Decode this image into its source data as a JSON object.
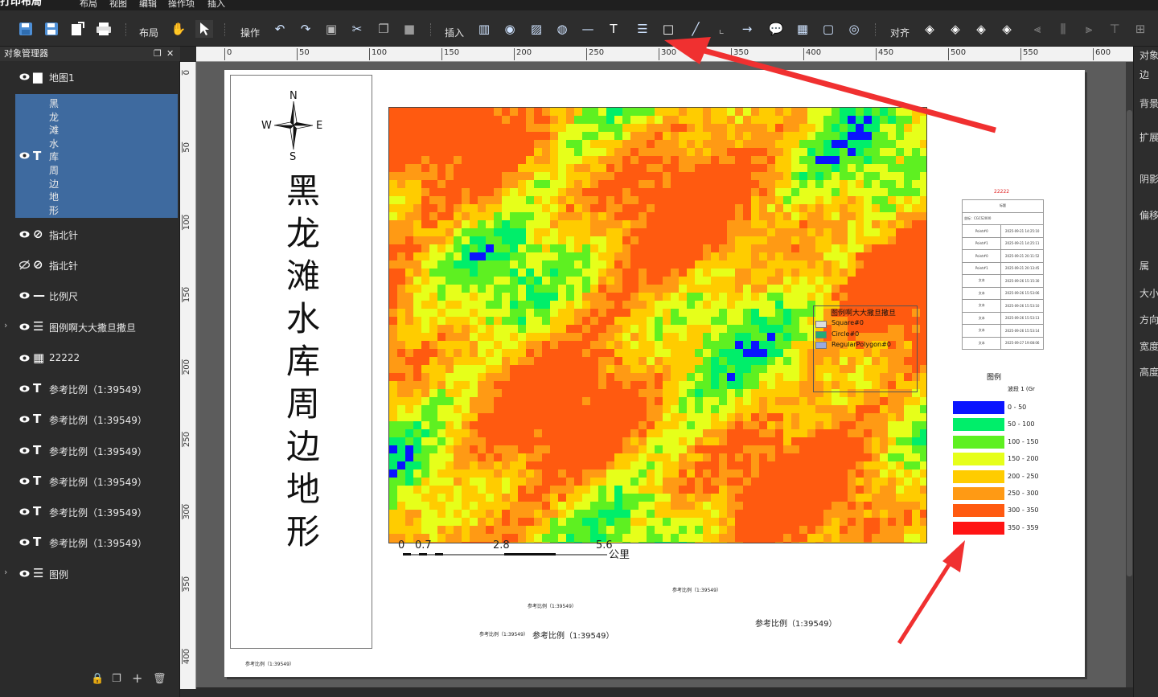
{
  "menubar": {
    "app_title": "打印布局",
    "items": [
      "布局",
      "视图",
      "编辑",
      "操作项",
      "插入"
    ]
  },
  "toolbar": {
    "group_labels": {
      "layout": "布局",
      "operate": "操作",
      "insert": "插入",
      "align": "对齐"
    }
  },
  "left_panel": {
    "title": "对象管理器",
    "items": [
      {
        "label": "地图1",
        "icon": "folder-icon"
      },
      {
        "label": "黑龙滩水库周边地形",
        "icon": "text-icon",
        "selected": true
      },
      {
        "label": "指北针",
        "icon": "compass-icon"
      },
      {
        "label": "指北针",
        "icon": "compass-icon",
        "hidden": true
      },
      {
        "label": "比例尺",
        "icon": "scalebar-icon"
      },
      {
        "label": "图例啊大大撒旦撒旦",
        "icon": "legend-icon",
        "expandable": true
      },
      {
        "label": "22222",
        "icon": "table-icon"
      },
      {
        "label": "参考比例（1:39549）",
        "icon": "text-icon"
      },
      {
        "label": "参考比例（1:39549）",
        "icon": "text-icon"
      },
      {
        "label": "参考比例（1:39549）",
        "icon": "text-icon"
      },
      {
        "label": "参考比例（1:39549）",
        "icon": "text-icon"
      },
      {
        "label": "参考比例（1:39549）",
        "icon": "text-icon"
      },
      {
        "label": "参考比例（1:39549）",
        "icon": "text-icon"
      },
      {
        "label": "图例",
        "icon": "legend-icon",
        "expandable": true
      }
    ]
  },
  "ruler": {
    "h": [
      "0",
      "50",
      "100",
      "150",
      "200",
      "250",
      "300",
      "350",
      "400",
      "450",
      "500",
      "550",
      "600"
    ],
    "v": [
      "0",
      "50",
      "100",
      "150",
      "200",
      "250",
      "300",
      "350",
      "400"
    ]
  },
  "page": {
    "compass": {
      "n": "N",
      "s": "S",
      "e": "E",
      "w": "W"
    },
    "title": "黑龙滩水库周边地形",
    "scalebar": {
      "ticks": [
        "0",
        "0.7",
        "2.8",
        "5.6"
      ],
      "unit": "公里"
    },
    "legend1": {
      "title": "图例啊大大撒旦撒旦",
      "items": [
        "Square#0",
        "Circle#0",
        "RegularPolygon#0"
      ]
    },
    "table": {
      "title": "22222",
      "header": "标题",
      "subheader": "坐标：CGCS2000",
      "rows": [
        [
          "Point#0",
          "2025-09-21 14:25:10"
        ],
        [
          "Point#1",
          "2025-09-21 14:25:11"
        ],
        [
          "Point#0",
          "2025-09-21 20:11:52"
        ],
        [
          "Point#1",
          "2025-09-21 20:13:45"
        ],
        [
          "文本",
          "2025-09-26 15:15:30"
        ],
        [
          "文本",
          "2025-09-26 15:53:06"
        ],
        [
          "文本",
          "2025-09-26 15:53:10"
        ],
        [
          "文本",
          "2025-09-26 15:53:13"
        ],
        [
          "文本",
          "2025-09-26 15:53:14"
        ],
        [
          "文本",
          "2025-09-27 19:08:06"
        ]
      ]
    },
    "legend2": {
      "title": "图例",
      "subtitle": "波段 1 (Gr",
      "items": [
        {
          "label": "0 - 50",
          "color": "#0a14ff"
        },
        {
          "label": "50 - 100",
          "color": "#00ee6a"
        },
        {
          "label": "100 - 150",
          "color": "#5ef021"
        },
        {
          "label": "150 - 200",
          "color": "#e6ff1a"
        },
        {
          "label": "200 - 250",
          "color": "#ffcc00"
        },
        {
          "label": "250 - 300",
          "color": "#ff9a14"
        },
        {
          "label": "300 - 350",
          "color": "#ff5a10"
        },
        {
          "label": "350 - 359",
          "color": "#ff1414"
        }
      ]
    },
    "ref_scales": {
      "a": "参考比例（1:39549）",
      "b": "参考比例（1:39549）",
      "c": "参考比例（1:39549）",
      "d": "参考比例（1:39549）",
      "e": "参考比例（1:39549）",
      "f": "参考比例（1:39549）"
    }
  },
  "right_panel": {
    "labels": [
      "对象",
      "边",
      "背景",
      "扩展",
      "阴影",
      "偏移",
      "属",
      "大小",
      "方向",
      "宽度",
      "高度"
    ]
  },
  "colors": {
    "accent_selection": "#3e6a9f",
    "arrow": "#f03030"
  }
}
